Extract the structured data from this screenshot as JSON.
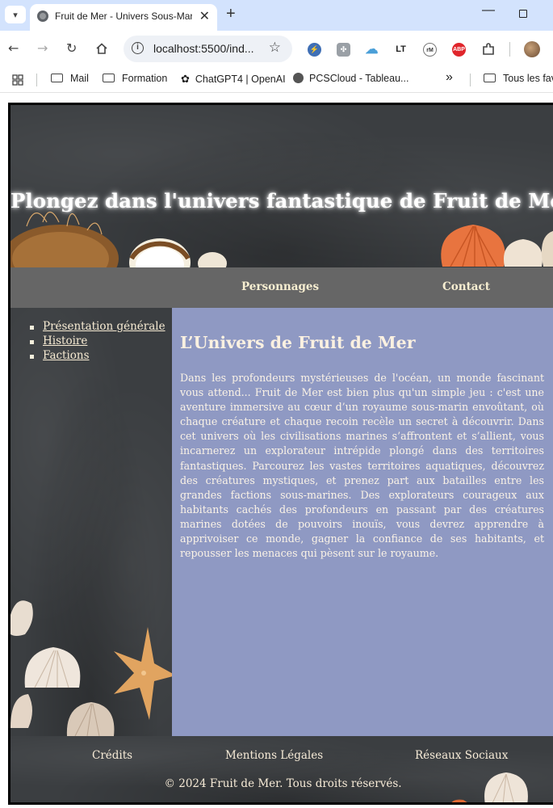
{
  "browser": {
    "tab_title": "Fruit de Mer - Univers Sous-Marin",
    "url": "localhost:5500/ind...",
    "bookmarks": [
      {
        "label": "Mail",
        "icon": "folder-icon"
      },
      {
        "label": "Formation",
        "icon": "folder-icon"
      },
      {
        "label": "ChatGPT4 | OpenAI",
        "icon": "openai-icon"
      },
      {
        "label": "PCSCloud - Tableau...",
        "icon": "globe-icon"
      },
      {
        "label": "Tous les favoris",
        "icon": "folder-icon"
      }
    ],
    "bookmarks_overflow": "»",
    "extensions": [
      "bolt-icon",
      "puzzle-app-icon",
      "cloud-icon",
      "lt-icon",
      "rm-icon",
      "abp-icon",
      "extensions-icon"
    ]
  },
  "colors": {
    "tabbar_bg": "#d3e3fd",
    "navbar_bg": "#666666",
    "main_bg": "#8f99c3",
    "chalkboard": "#3b3e41",
    "link_text": "#f7ebd3"
  },
  "hero": {
    "title": "Plongez dans l'univers fantastique de Fruit de Mer"
  },
  "nav": {
    "items": [
      "Personnages",
      "Contact"
    ]
  },
  "sidebar": {
    "items": [
      "Présentation générale",
      "Histoire",
      "Factions"
    ]
  },
  "main": {
    "heading": "L’Univers de Fruit de Mer",
    "paragraph": "Dans les profondeurs mystérieuses de l'océan, un monde fascinant vous attend... Fruit de Mer est bien plus qu'un simple jeu : c'est une aventure immersive au cœur d’un royaume sous-marin envoûtant, où chaque créature et chaque recoin recèle un secret à découvrir. Dans cet univers où les civilisations marines s’affrontent et s’allient, vous incarnerez un explorateur intrépide plongé dans des territoires fantastiques. Parcourez les vastes territoires aquatiques, découvrez des créatures mystiques, et prenez part aux batailles entre les grandes factions sous-marines. Des explorateurs courageux aux habitants cachés des profondeurs en passant par des créatures marines dotées de pouvoirs inouïs, vous devrez apprendre à apprivoiser ce monde, gagner la confiance de ses habitants, et repousser les menaces qui pèsent sur le royaume."
  },
  "footer": {
    "links": [
      "Crédits",
      "Mentions Légales",
      "Réseaux Sociaux"
    ],
    "copyright": "© 2024 Fruit de Mer. Tous droits réservés."
  }
}
